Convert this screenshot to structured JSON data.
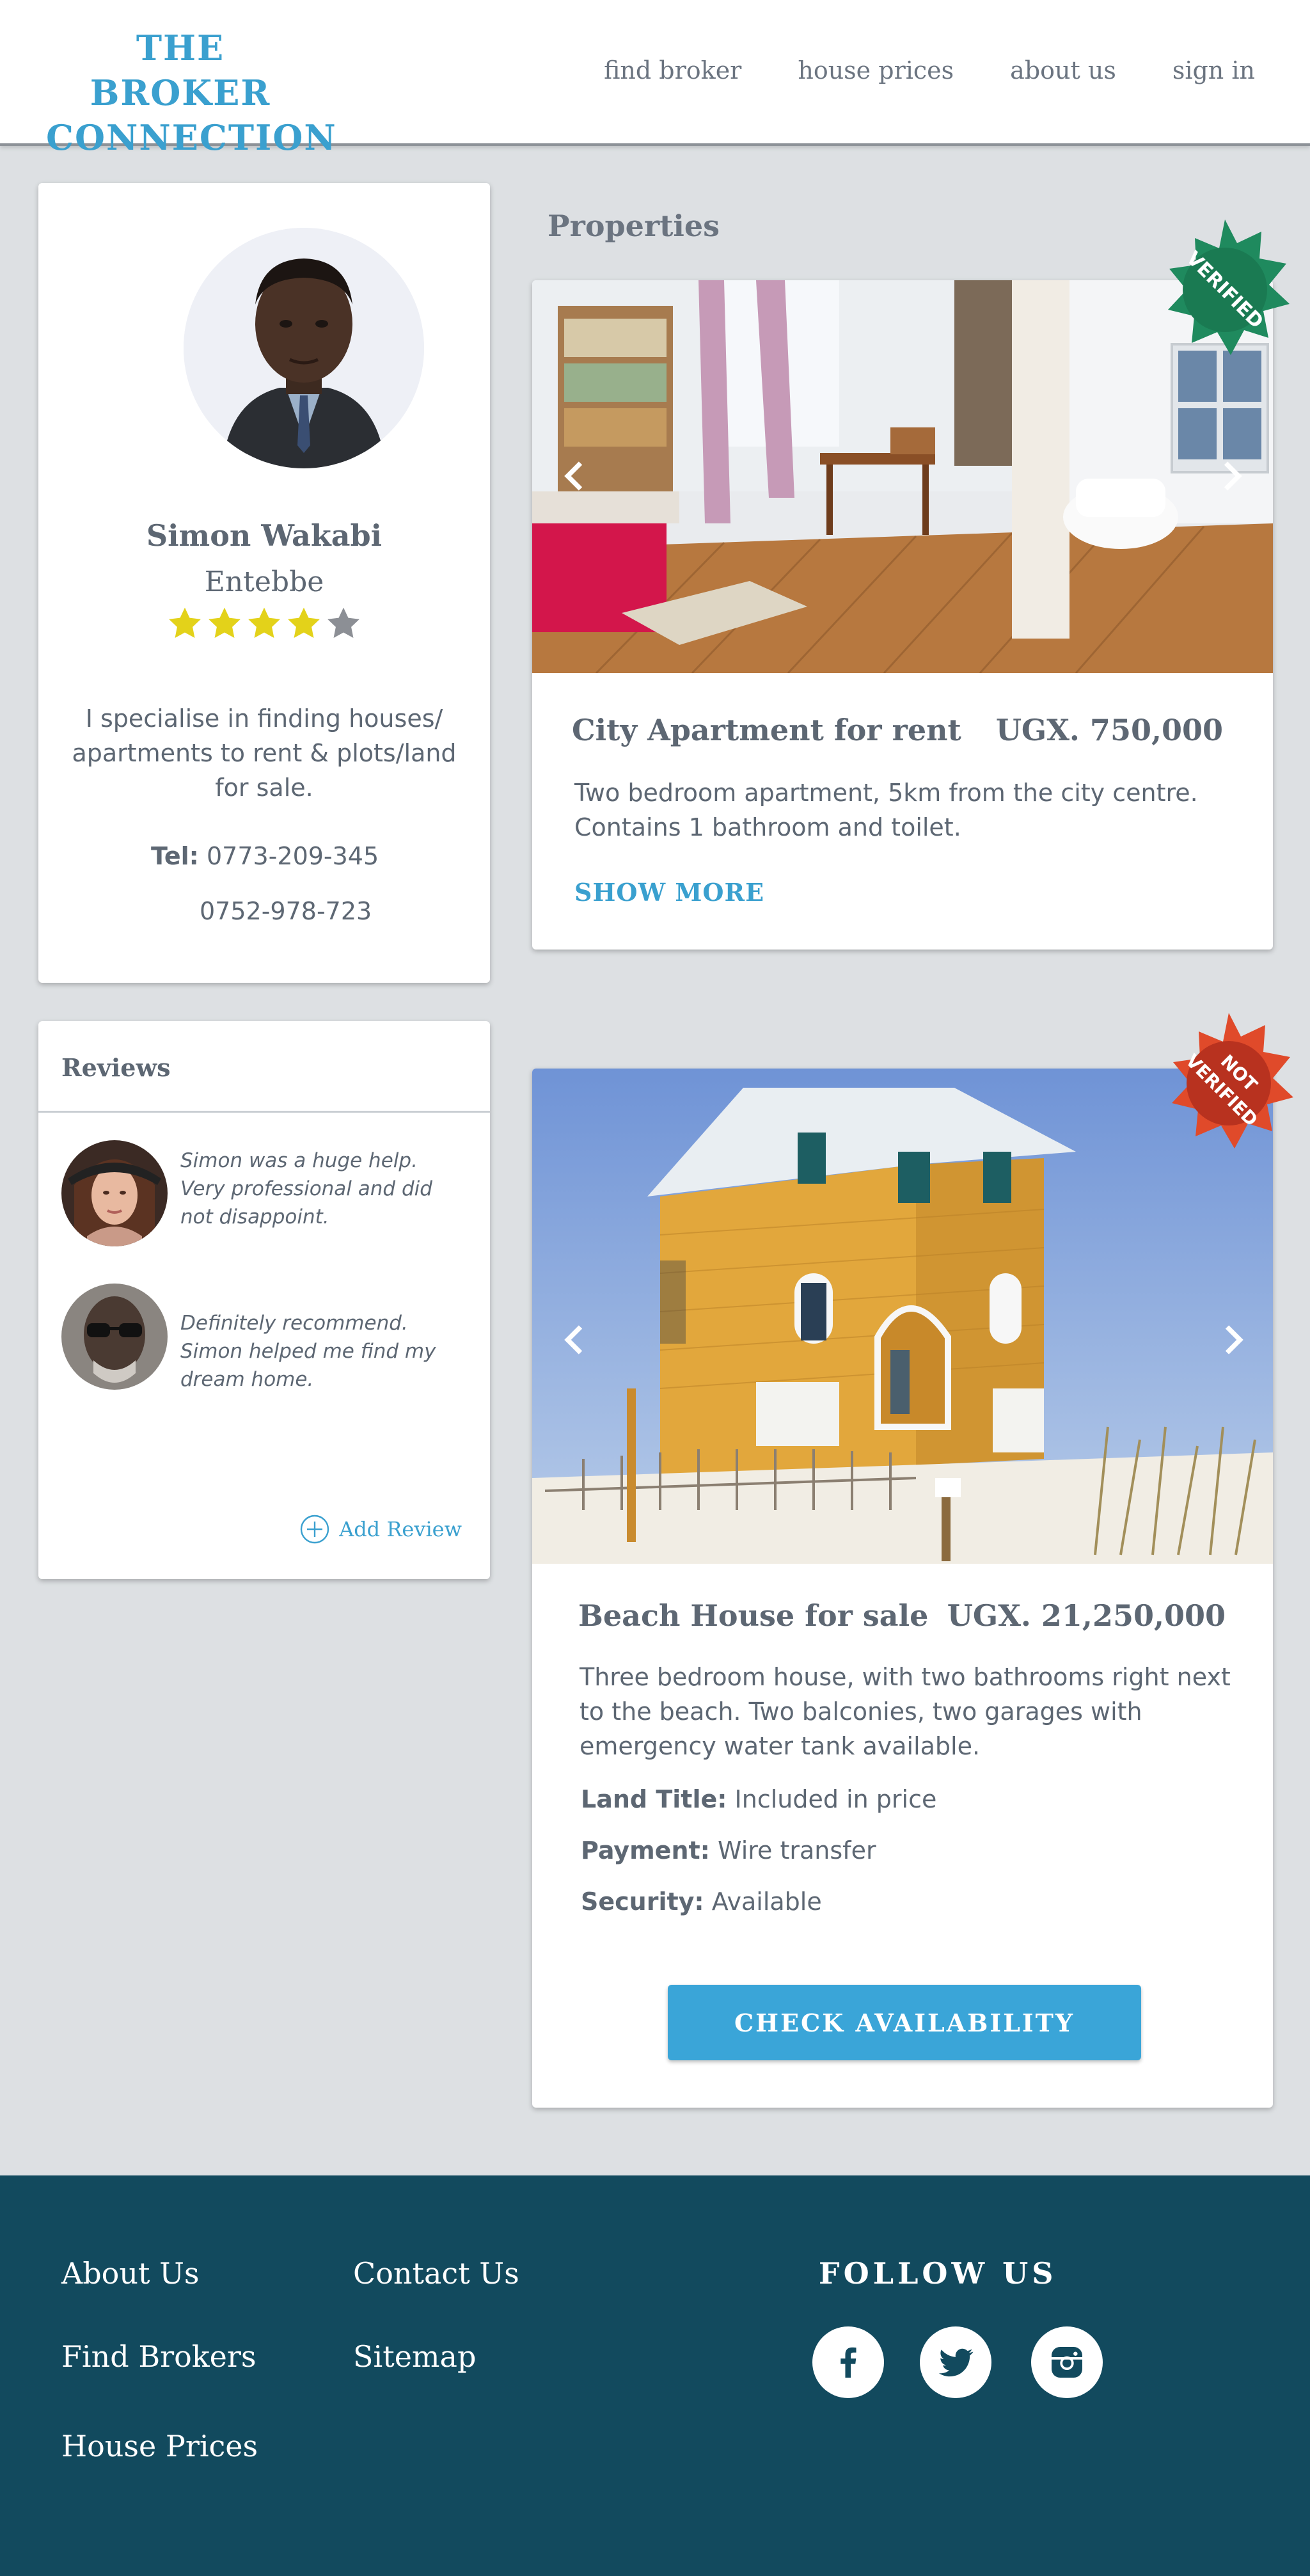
{
  "header": {
    "logo_line1": "THE BROKER",
    "logo_line2": "CONNECTION",
    "nav": [
      "find broker",
      "house prices",
      "about us",
      "sign in"
    ]
  },
  "profile": {
    "name": "Simon Wakabi",
    "city": "Entebbe",
    "rating": 4,
    "rating_max": 5,
    "bio": "I specialise in finding houses/ apartments to rent & plots/land for sale.",
    "tel_label": "Tel:",
    "phones": [
      "0773-209-345",
      "0752-978-723"
    ]
  },
  "reviews": {
    "title": "Reviews",
    "items": [
      {
        "text": "Simon was a huge help. Very professional and did not disappoint."
      },
      {
        "text": "Definitely recommend. Simon helped me find my dream home."
      }
    ],
    "add_label": "Add Review"
  },
  "properties": {
    "title": "Properties",
    "items": [
      {
        "badge": "VERIFIED",
        "title": "City Apartment for rent",
        "price": "UGX. 750,000",
        "description": "Two bedroom apartment, 5km from the city centre. Contains 1 bathroom and toilet.",
        "show_more": "SHOW MORE"
      },
      {
        "badge_line1": "NOT",
        "badge_line2": "VERIFIED",
        "title": "Beach House for sale",
        "price": "UGX. 21,250,000",
        "description": "Three bedroom house, with two bathrooms right next to the beach. Two balconies, two garages with emergency water tank available.",
        "details": [
          {
            "label": "Land Title:",
            "value": "Included in price"
          },
          {
            "label": "Payment:",
            "value": "Wire transfer"
          },
          {
            "label": "Security:",
            "value": "Available"
          }
        ],
        "cta": "CHECK AVAILABILITY"
      }
    ]
  },
  "footer": {
    "links": [
      "About Us",
      "Contact Us",
      "Find Brokers",
      "Sitemap",
      "House Prices"
    ],
    "follow": "FOLLOW US",
    "social": [
      "facebook-icon",
      "twitter-icon",
      "instagram-icon"
    ]
  },
  "colors": {
    "accent": "#3aa0cf",
    "verified": "#1f8a5e",
    "not_verified": "#d64a2a",
    "footer": "#124a5e",
    "star": "#e3d21a"
  }
}
